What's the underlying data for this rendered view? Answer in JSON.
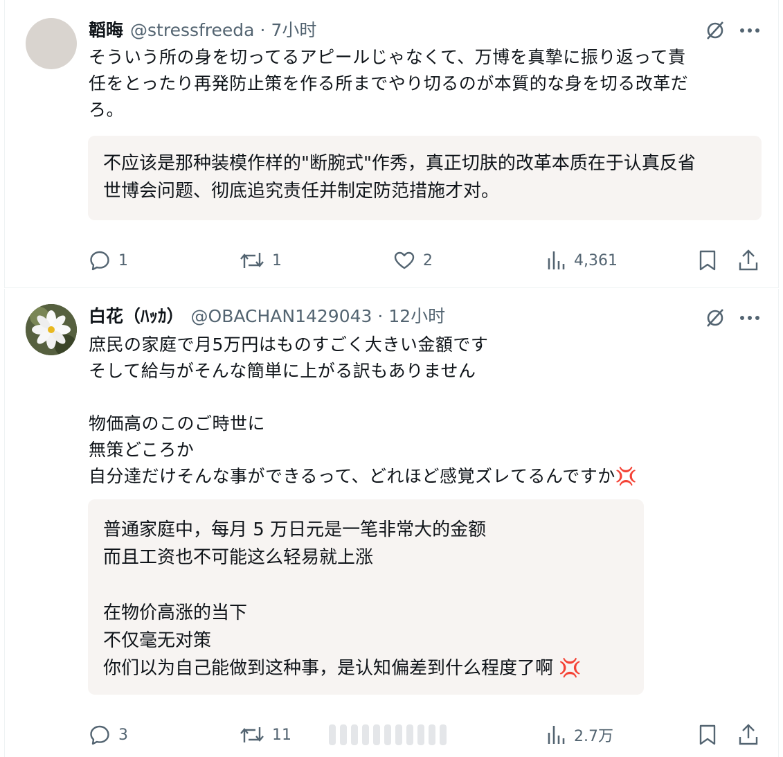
{
  "tweets": [
    {
      "name": "韜晦",
      "handle": "@stressfreeda",
      "time": "7小时",
      "text": "そういう所の身を切ってるアピールじゃなくて、万博を真摯に振り返って責\n任をとったり再発防止策を作る所までやり切るのが本質的な身を切る改革だ\nろ。",
      "translation": "不应该是那种装模作样的\"断腕式\"作秀，真正切肤的改革本质在于认真反省\n世博会问题、彻底追究责任并制定防范措施才对。",
      "replies": "1",
      "reposts": "1",
      "likes": "2",
      "views": "4,361"
    },
    {
      "name": "白花（ﾊｯｶ）",
      "handle": "@OBACHAN1429043",
      "time": "12小时",
      "text": "庶民の家庭で月5万円はものすごく大きい金額です\nそして給与がそんな簡単に上がる訳もありません\n\n物価高のこのご時世に\n無策どころか\n自分達だけそんな事ができるって、どれほど感覚ズレてるんですか💢",
      "translation": "普通家庭中，每月 5 万日元是一笔非常大的金额\n而且工资也不可能这么轻易就上涨\n\n在物价高涨的当下\n不仅毫无对策\n你们以为自己能做到这种事，是认知偏差到什么程度了啊 💢",
      "replies": "3",
      "reposts": "11",
      "views": "2.7万"
    }
  ],
  "colors": {
    "text": "#0f1419",
    "muted": "#536471",
    "translation_bg": "#f7f4f2",
    "divider": "#eff3f4"
  },
  "icons": [
    "grok-icon",
    "more-icon",
    "reply-icon",
    "repost-icon",
    "like-icon",
    "views-icon",
    "bookmark-icon",
    "share-icon"
  ]
}
